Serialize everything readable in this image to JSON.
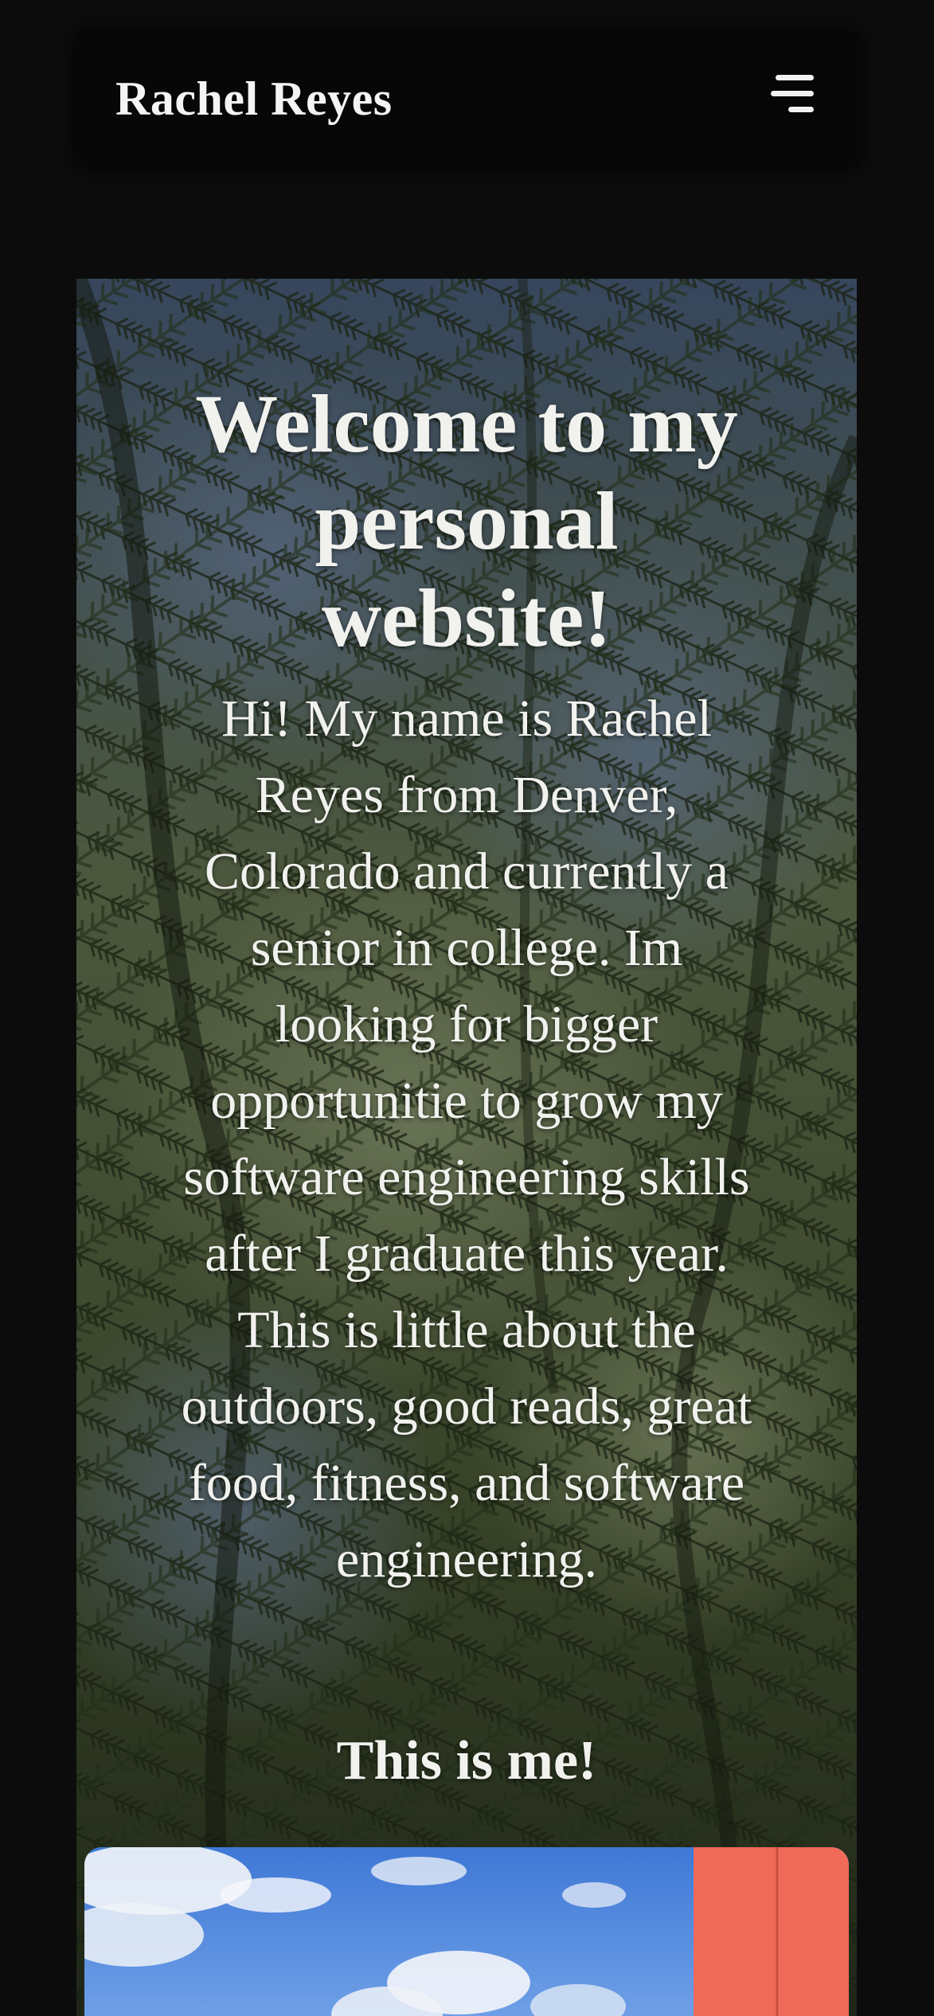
{
  "header": {
    "brand": "Rachel Reyes",
    "menu_icon": "hamburger-menu-icon"
  },
  "hero": {
    "background": "forest-canopy-photo",
    "title": "Welcome to my personal website!",
    "intro": "Hi! My name is Rachel Reyes from Denver, Colorado and currently a senior in college. Im looking for bigger opportunitie to grow my software engineering skills after I graduate this year. This is little about the outdoors, good reads, great food, fitness, and software engineering.",
    "me_heading": "This is me!"
  },
  "colors": {
    "page_background": "#0c0c0c",
    "navbar_background": "#070707",
    "text": "#f1f1ee"
  }
}
